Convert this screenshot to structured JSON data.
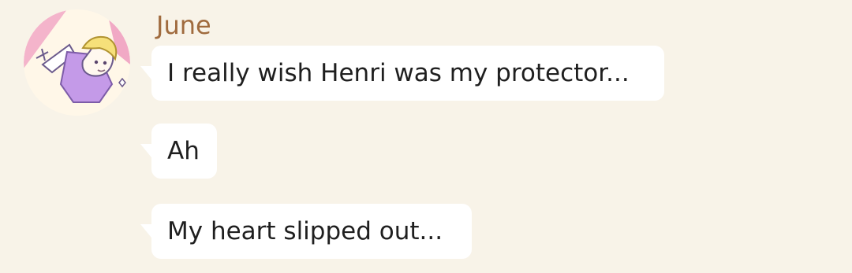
{
  "chat": {
    "sender": {
      "name": "June",
      "avatar_icon": "character-avatar-icon"
    },
    "messages": [
      {
        "text": "I really wish Henri was my protector..."
      },
      {
        "text": "Ah"
      },
      {
        "text": "My heart slipped out..."
      }
    ]
  },
  "colors": {
    "background": "#f8f3e8",
    "name": "#a06b3e",
    "bubble": "#ffffff",
    "text": "#1f1f1f",
    "avatar_accent_pink": "#f2a7c4",
    "avatar_accent_purple": "#c49ae8",
    "avatar_hair": "#f6e07a"
  }
}
